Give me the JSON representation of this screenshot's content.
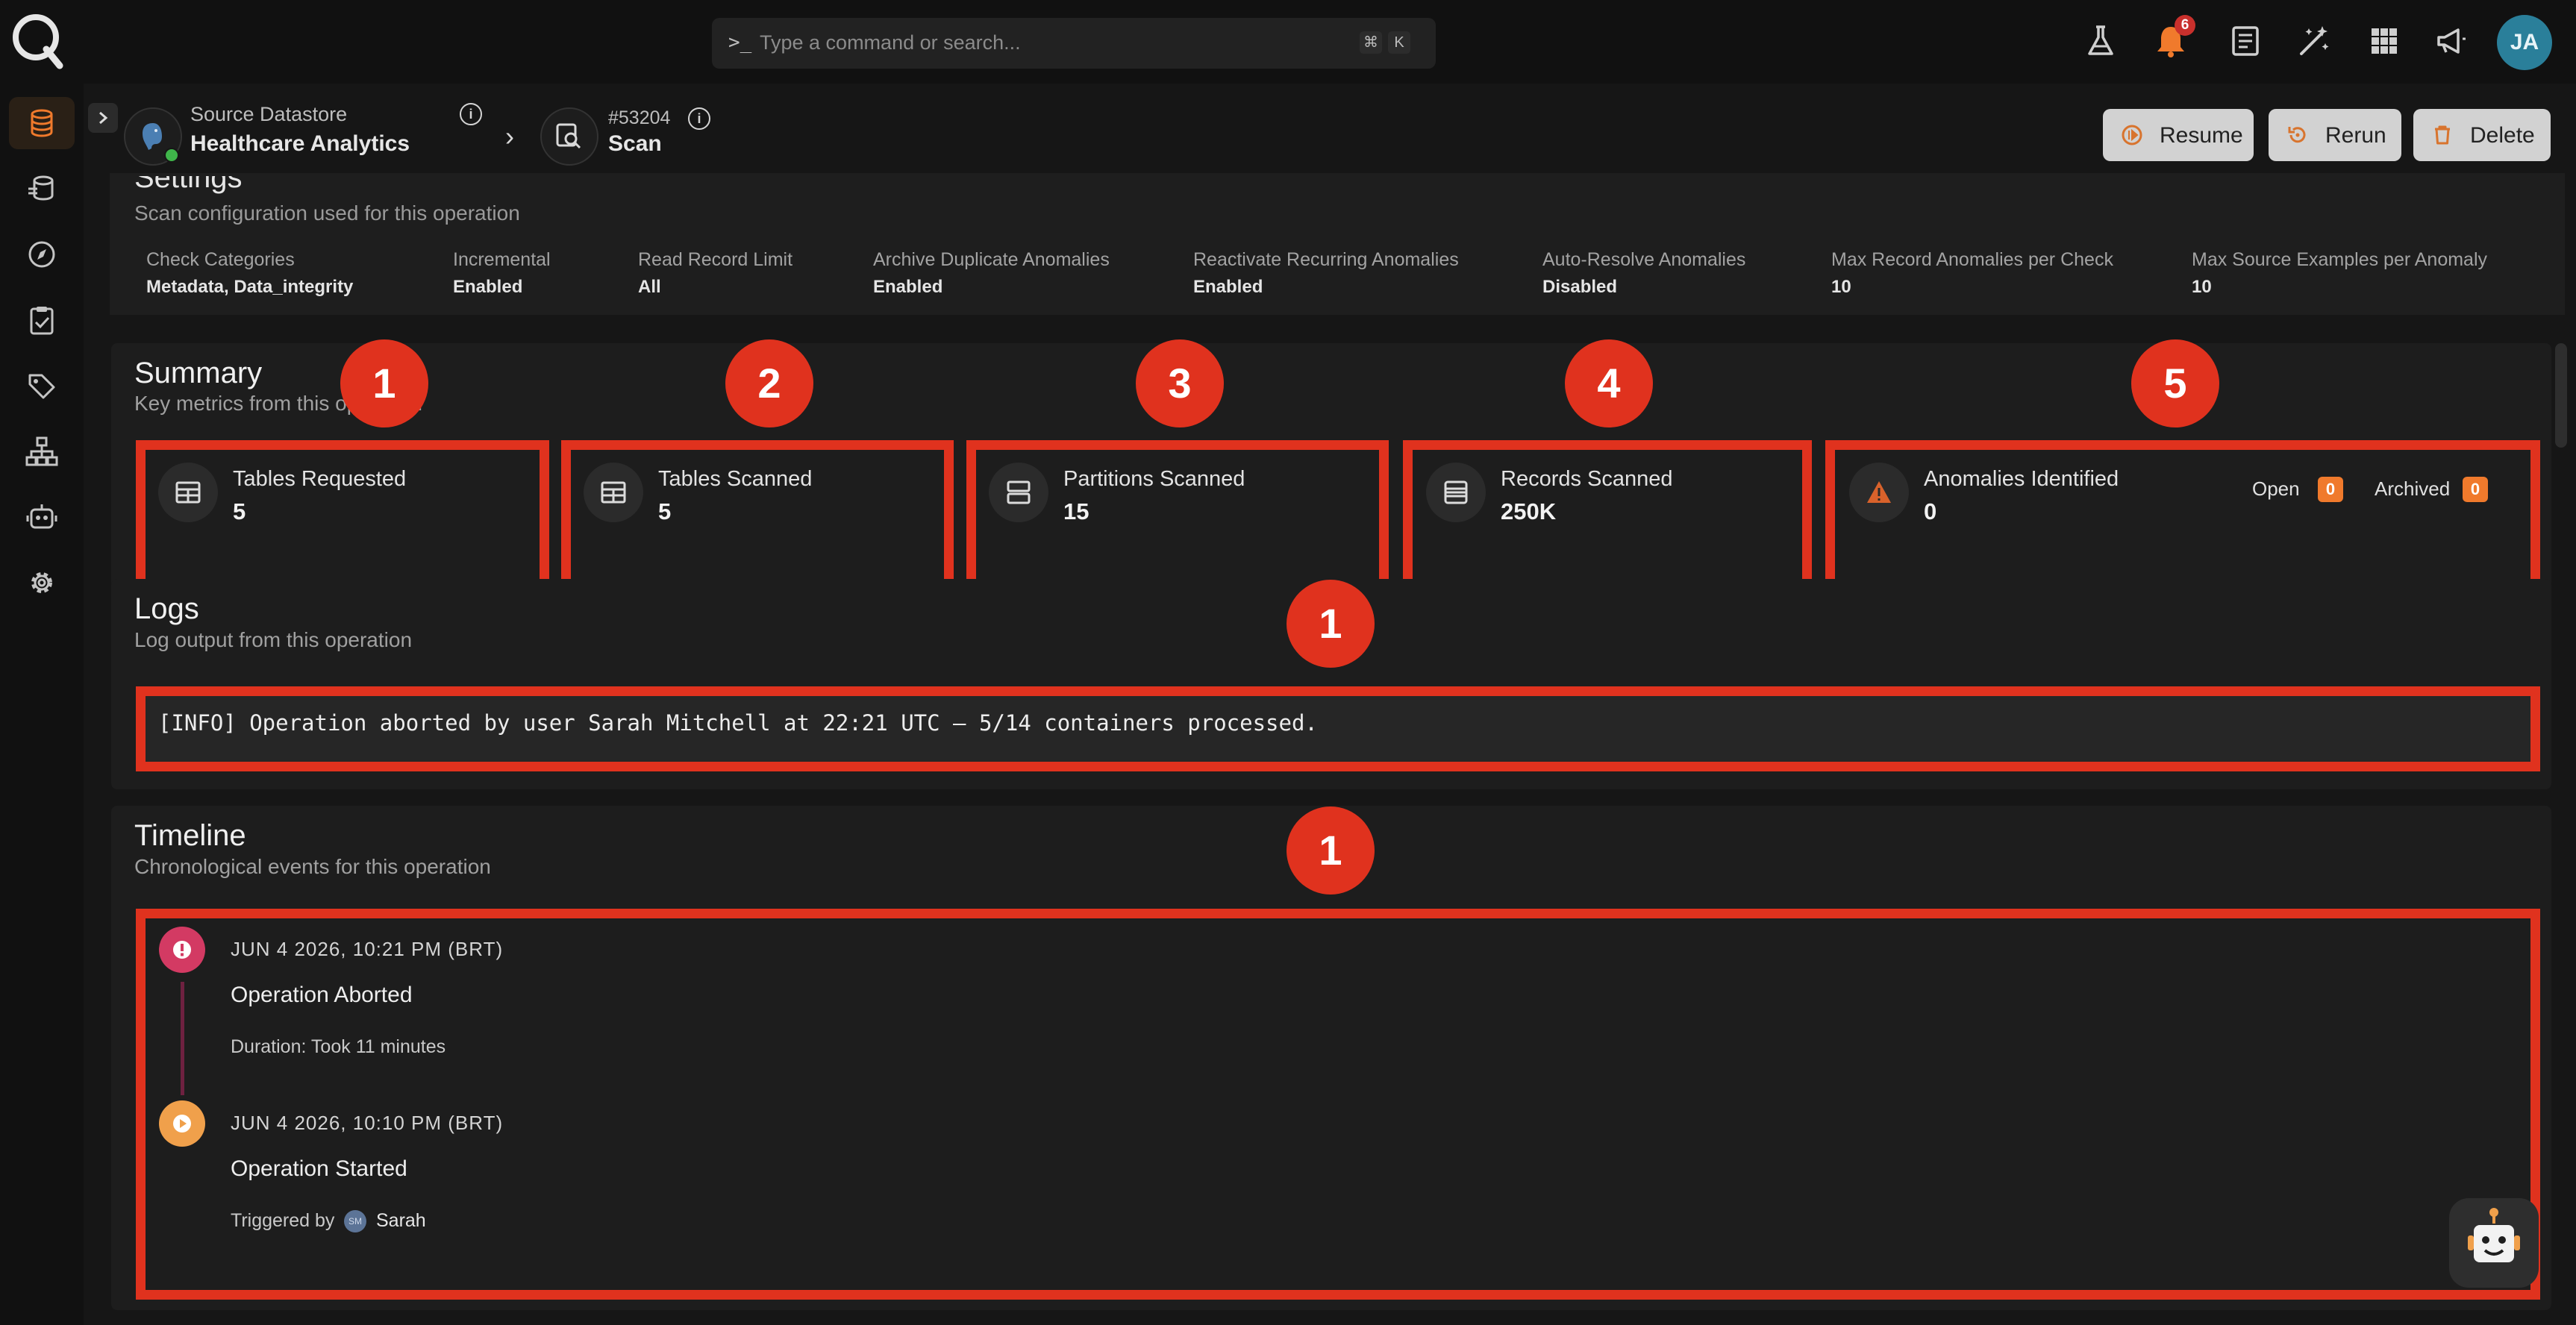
{
  "topbar": {
    "command_prompt": ">_",
    "command_placeholder": "Type a command or search...",
    "shortcut_mod": "⌘",
    "shortcut_key": "K",
    "notification_count": "6",
    "user_initials": "JA"
  },
  "sidebar": {
    "items": [
      {
        "icon": "database-icon",
        "active": true
      },
      {
        "icon": "datastore-sync-icon"
      },
      {
        "icon": "compass-icon"
      },
      {
        "icon": "clipboard-check-icon"
      },
      {
        "icon": "tag-icon"
      },
      {
        "icon": "sitemap-icon"
      },
      {
        "icon": "robot-icon"
      },
      {
        "icon": "gear-icon"
      }
    ]
  },
  "breadcrumb": {
    "datastore_label": "Source Datastore",
    "datastore_name": "Healthcare Analytics",
    "operation_id": "#53204",
    "operation_type": "Scan"
  },
  "actions": {
    "resume": "Resume",
    "rerun": "Rerun",
    "delete": "Delete"
  },
  "settings": {
    "title": "Settings",
    "subtitle": "Scan configuration used for this operation",
    "fields": [
      {
        "label": "Check Categories",
        "value": "Metadata, Data_integrity"
      },
      {
        "label": "Incremental",
        "value": "Enabled"
      },
      {
        "label": "Read Record Limit",
        "value": "All"
      },
      {
        "label": "Archive Duplicate Anomalies",
        "value": "Enabled"
      },
      {
        "label": "Reactivate Recurring Anomalies",
        "value": "Enabled"
      },
      {
        "label": "Auto-Resolve Anomalies",
        "value": "Disabled"
      },
      {
        "label": "Max Record Anomalies per Check",
        "value": "10"
      },
      {
        "label": "Max Source Examples per Anomaly",
        "value": "10"
      }
    ]
  },
  "summary": {
    "title": "Summary",
    "subtitle": "Key metrics from this operation",
    "metrics": [
      {
        "label": "Tables Requested",
        "value": "5",
        "marker": "1"
      },
      {
        "label": "Tables Scanned",
        "value": "5",
        "marker": "2"
      },
      {
        "label": "Partitions Scanned",
        "value": "15",
        "marker": "3"
      },
      {
        "label": "Records Scanned",
        "value": "250K",
        "marker": "4"
      },
      {
        "label": "Anomalies Identified",
        "value": "0",
        "marker": "5"
      }
    ],
    "open_label": "Open",
    "open_count": "0",
    "archived_label": "Archived",
    "archived_count": "0"
  },
  "logs": {
    "title": "Logs",
    "subtitle": "Log output from this operation",
    "marker": "1",
    "line": "[INFO] Operation aborted by user Sarah Mitchell at 22:21 UTC — 5/14 containers processed."
  },
  "timeline": {
    "title": "Timeline",
    "subtitle": "Chronological events for this operation",
    "marker": "1",
    "events": [
      {
        "date": "JUN 4 2026, 10:21 PM (BRT)",
        "title": "Operation Aborted",
        "meta": "Duration: Took 11 minutes",
        "color": "#d33a63"
      },
      {
        "date": "JUN 4 2026, 10:10 PM (BRT)",
        "title": "Operation Started",
        "meta_prefix": "Triggered by",
        "user_initials": "SM",
        "user": "Sarah",
        "color": "#f0a04b"
      }
    ]
  },
  "colors": {
    "annotation_red": "#e0321e",
    "accent_orange": "#f07a2c"
  }
}
